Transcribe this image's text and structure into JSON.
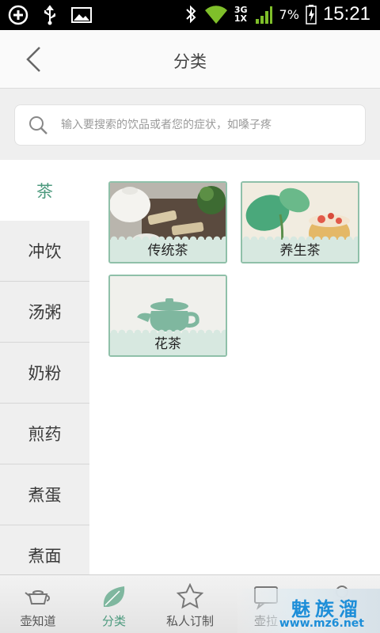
{
  "status_bar": {
    "network_top": "3G",
    "network_bottom": "1X",
    "battery": "7%",
    "time": "15:21"
  },
  "header": {
    "title": "分类"
  },
  "search": {
    "placeholder": "输入要搜索的饮品或者您的症状，如嗓子疼"
  },
  "sidebar": {
    "items": [
      {
        "label": "茶"
      },
      {
        "label": "冲饮"
      },
      {
        "label": "汤粥"
      },
      {
        "label": "奶粉"
      },
      {
        "label": "煎药"
      },
      {
        "label": "煮蛋"
      },
      {
        "label": "煮面"
      }
    ]
  },
  "categories": [
    {
      "label": "传统茶"
    },
    {
      "label": "养生茶"
    },
    {
      "label": "花茶"
    }
  ],
  "bottom_nav": {
    "items": [
      {
        "label": "壶知道"
      },
      {
        "label": "分类"
      },
      {
        "label": "私人订制"
      },
      {
        "label": "壶拉"
      },
      {
        "label": ""
      }
    ]
  },
  "watermark": {
    "main": "魅族溜",
    "url": "www.mz6.net"
  },
  "colors": {
    "accent": "#4d9a7e",
    "card_border": "#8fc0a9",
    "card_label_bg": "#d7e8e0"
  }
}
